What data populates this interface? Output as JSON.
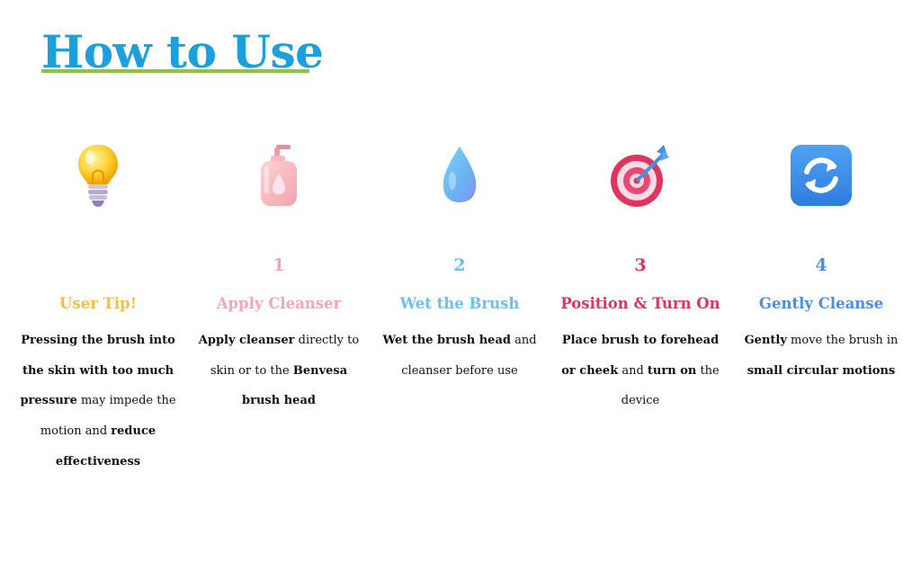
{
  "title": "How to Use",
  "colors": {
    "title": "#1aa0dd",
    "underline": "#8cc63f",
    "tip": "#f5be47",
    "step1": "#f2a7b4",
    "step2": "#6cc1f0",
    "step3": "#e0335e",
    "step4": "#4a90e2"
  },
  "tip": {
    "icon": "light-bulb-icon",
    "title": "User Tip!",
    "desc": [
      {
        "t": "Pressing the brush into the skin with too much pressure",
        "b": true
      },
      {
        "t": " may impede the motion and ",
        "b": false
      },
      {
        "t": "reduce effectiveness",
        "b": true
      }
    ]
  },
  "steps": [
    {
      "num": "1",
      "icon": "lotion-bottle-icon",
      "title": "Apply Cleanser",
      "desc": [
        {
          "t": "Apply cleanser",
          "b": true
        },
        {
          "t": " directly to skin or to the ",
          "b": false
        },
        {
          "t": "Benvesa brush head",
          "b": true
        }
      ]
    },
    {
      "num": "2",
      "icon": "water-drop-icon",
      "title": "Wet the Brush",
      "desc": [
        {
          "t": "Wet the brush head",
          "b": true
        },
        {
          "t": " and cleanser before use",
          "b": false
        }
      ]
    },
    {
      "num": "3",
      "icon": "target-icon",
      "title": "Position & Turn On",
      "desc": [
        {
          "t": "Place brush to forehead or cheek",
          "b": true
        },
        {
          "t": " and ",
          "b": false
        },
        {
          "t": "turn on",
          "b": true
        },
        {
          "t": " the device",
          "b": false
        }
      ]
    },
    {
      "num": "4",
      "icon": "refresh-icon",
      "title": "Gently Cleanse",
      "desc": [
        {
          "t": "Gently",
          "b": true
        },
        {
          "t": " move the brush in ",
          "b": false
        },
        {
          "t": "small circular motions",
          "b": true
        }
      ]
    }
  ]
}
